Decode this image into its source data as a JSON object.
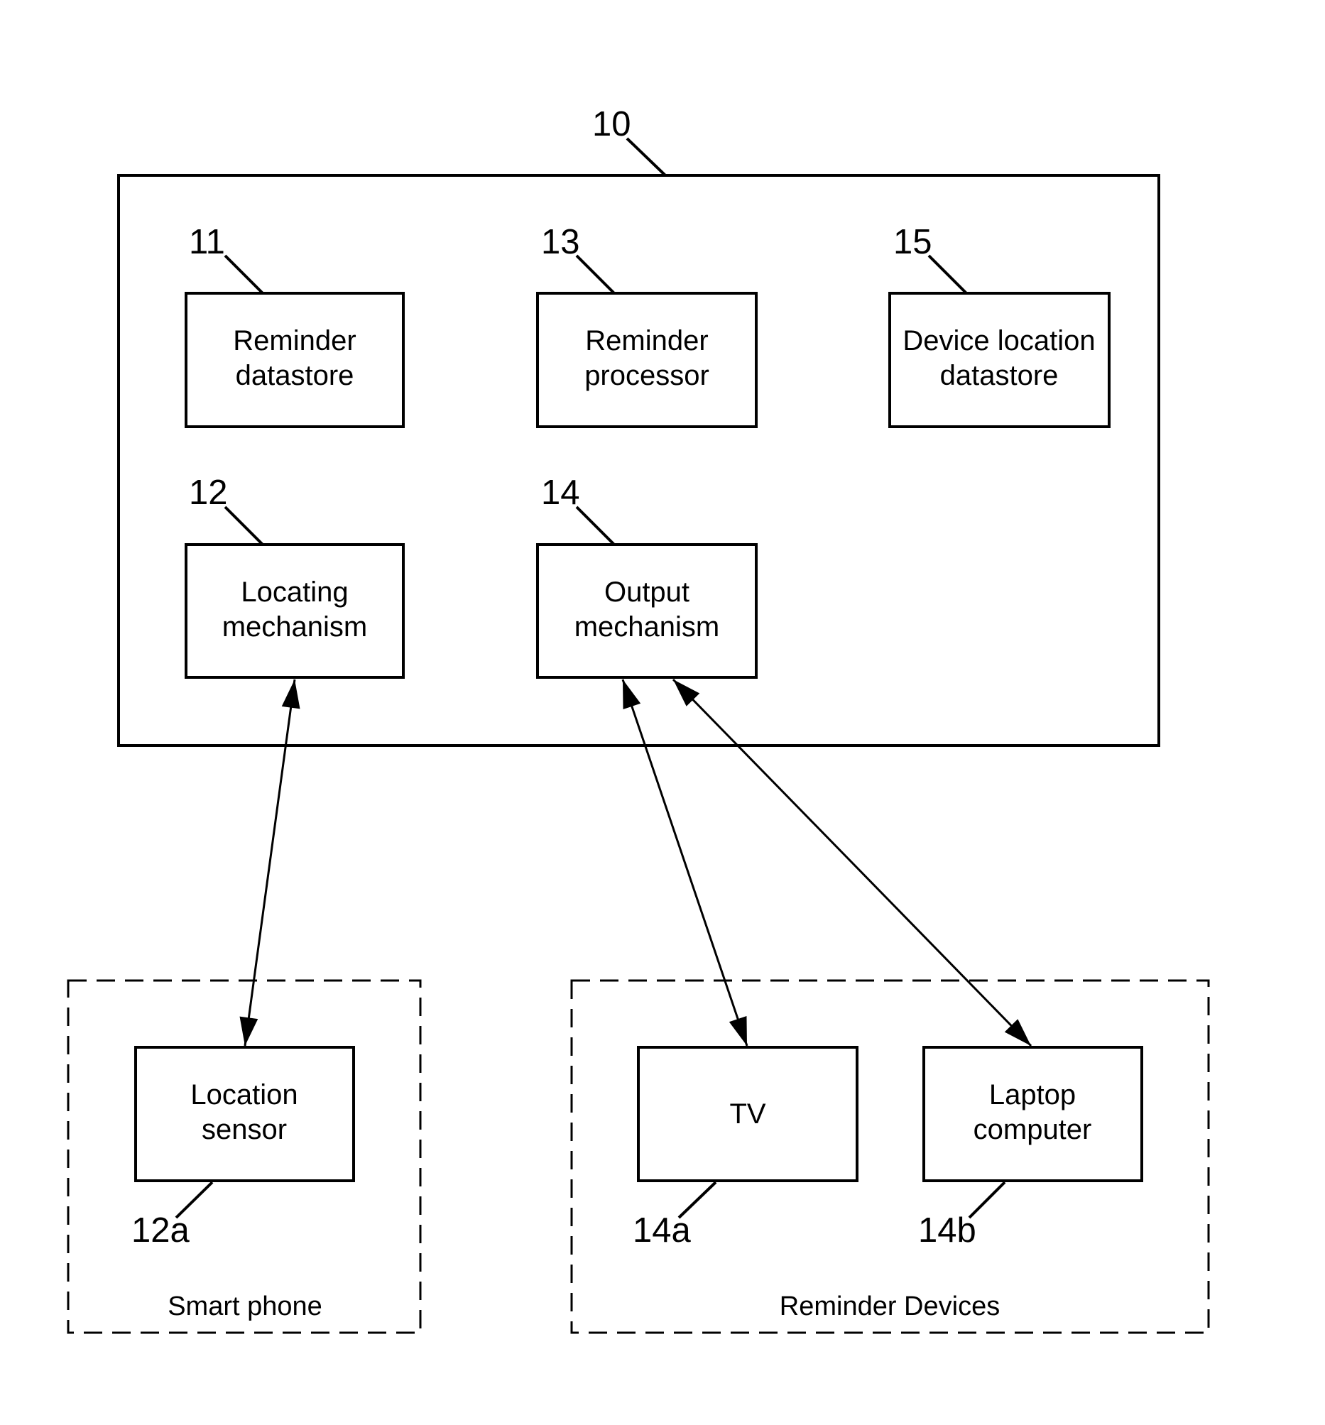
{
  "diagram": {
    "system": {
      "ref": "10"
    },
    "components": [
      {
        "id": "reminder-datastore",
        "ref": "11",
        "lines": [
          "Reminder",
          "datastore"
        ]
      },
      {
        "id": "reminder-processor",
        "ref": "13",
        "lines": [
          "Reminder",
          "processor"
        ]
      },
      {
        "id": "device-location-datastore",
        "ref": "15",
        "lines": [
          "Device location",
          "datastore"
        ]
      },
      {
        "id": "locating-mechanism",
        "ref": "12",
        "lines": [
          "Locating",
          "mechanism"
        ]
      },
      {
        "id": "output-mechanism",
        "ref": "14",
        "lines": [
          "Output",
          "mechanism"
        ]
      }
    ],
    "groups": [
      {
        "id": "smart-phone",
        "label": "Smart phone"
      },
      {
        "id": "reminder-devices",
        "label": "Reminder Devices"
      }
    ],
    "devices": [
      {
        "id": "location-sensor",
        "ref": "12a",
        "lines": [
          "Location",
          "sensor"
        ]
      },
      {
        "id": "tv",
        "ref": "14a",
        "lines": [
          "TV"
        ]
      },
      {
        "id": "laptop-computer",
        "ref": "14b",
        "lines": [
          "Laptop",
          "computer"
        ]
      }
    ],
    "connections": [
      {
        "from": "locating-mechanism",
        "to": "location-sensor",
        "direction": "bidirectional"
      },
      {
        "from": "output-mechanism",
        "to": "tv",
        "direction": "bidirectional"
      },
      {
        "from": "output-mechanism",
        "to": "laptop-computer",
        "direction": "bidirectional"
      }
    ]
  }
}
